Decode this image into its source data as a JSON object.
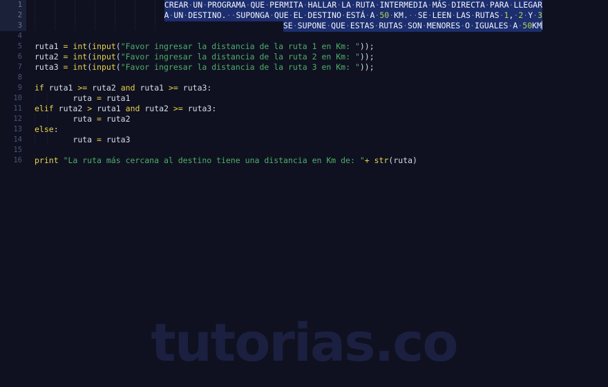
{
  "editor": {
    "background": "#0f1120",
    "gutter_color": "#4a5375",
    "selection_color": "#1c2e6e",
    "language": "python"
  },
  "watermark": {
    "text": "tutorias.co",
    "color": "#1b2040"
  },
  "gutter": {
    "numbers": [
      "1",
      "2",
      "3",
      "4",
      "5",
      "6",
      "7",
      "8",
      "9",
      "10",
      "11",
      "12",
      "13",
      "14",
      "15",
      "16"
    ]
  },
  "selection": {
    "active": true,
    "lines": [
      1,
      2,
      3
    ],
    "text": "CREAR UN PROGRAMA QUE PERMITA HALLAR LA RUTA INTERMEDIA MÁS DIRECTA PARA LLEGAR A UN DESTINO. SUPONGA QUE EL DESTINO ESTÁ A 50 KM. SE LEEN LAS RUTAS 1, 2 Y 3 SE SUPONE QUE ESTAS RUTAS SON MENORES O IGUALES A 50KM"
  },
  "comment_block": {
    "line1": {
      "parts": [
        {
          "text": "CREAR",
          "kind": "word"
        },
        {
          "text": "UN",
          "kind": "word"
        },
        {
          "text": "PROGRAMA",
          "kind": "word"
        },
        {
          "text": "QUE",
          "kind": "word"
        },
        {
          "text": "PERMITA",
          "kind": "word"
        },
        {
          "text": "HALLAR",
          "kind": "word"
        },
        {
          "text": "LA",
          "kind": "word"
        },
        {
          "text": "RUTA",
          "kind": "word"
        },
        {
          "text": "INTERMEDIA",
          "kind": "word"
        },
        {
          "text": "MÁS",
          "kind": "word"
        },
        {
          "text": "DIRECTA",
          "kind": "word"
        },
        {
          "text": "PARA",
          "kind": "word"
        },
        {
          "text": "LLEGAR",
          "kind": "word"
        }
      ]
    },
    "line2": {
      "parts": [
        {
          "text": "A",
          "kind": "word"
        },
        {
          "text": "UN",
          "kind": "word"
        },
        {
          "text": "DESTINO.",
          "kind": "word"
        },
        {
          "text": "",
          "kind": "word"
        },
        {
          "text": "SUPONGA",
          "kind": "word"
        },
        {
          "text": "QUE",
          "kind": "word"
        },
        {
          "text": "EL",
          "kind": "word"
        },
        {
          "text": "DESTINO",
          "kind": "word"
        },
        {
          "text": "ESTÁ",
          "kind": "word"
        },
        {
          "text": "A",
          "kind": "word"
        },
        {
          "text": "50",
          "kind": "num"
        },
        {
          "text": "KM.",
          "kind": "word"
        },
        {
          "text": "",
          "kind": "word"
        },
        {
          "text": "SE",
          "kind": "word"
        },
        {
          "text": "LEEN",
          "kind": "word"
        },
        {
          "text": "LAS",
          "kind": "word"
        },
        {
          "text": "RUTAS",
          "kind": "word"
        },
        {
          "text": "1",
          "kind": "num"
        },
        {
          "text": ",",
          "kind": "punct-inline"
        },
        {
          "text": "2",
          "kind": "num"
        },
        {
          "text": "Y",
          "kind": "word"
        },
        {
          "text": "3",
          "kind": "num"
        }
      ]
    },
    "line3": {
      "parts": [
        {
          "text": "SE",
          "kind": "word"
        },
        {
          "text": "SUPONE",
          "kind": "word"
        },
        {
          "text": "QUE",
          "kind": "word"
        },
        {
          "text": "ESTAS",
          "kind": "word"
        },
        {
          "text": "RUTAS",
          "kind": "word"
        },
        {
          "text": "SON",
          "kind": "word"
        },
        {
          "text": "MENORES",
          "kind": "word"
        },
        {
          "text": "O",
          "kind": "word"
        },
        {
          "text": "IGUALES",
          "kind": "word"
        },
        {
          "text": "A",
          "kind": "word"
        },
        {
          "text": "50KM",
          "kind": "mixed",
          "num": "50",
          "word": "KM"
        }
      ]
    }
  },
  "code": {
    "line5": "ruta1 = int(input(\"Favor ingresar la distancia de la ruta 1 en Km: \"));",
    "line6": "ruta2 = int(input(\"Favor ingresar la distancia de la ruta 2 en Km: \"));",
    "line7": "ruta3 = int(input(\"Favor ingresar la distancia de la ruta 3 en Km: \"));",
    "line9": "if ruta1 >= ruta2 and ruta1 >= ruta3:",
    "line10": "        ruta = ruta1",
    "line11": "elif ruta2 > ruta1 and ruta2 >= ruta3:",
    "line12": "        ruta = ruta2",
    "line13": "else:",
    "line14": "        ruta = ruta3",
    "line16": "print \"La ruta más cercana al destino tiene una distancia en Km de: \"+ str(ruta)"
  },
  "tokens": {
    "var_ruta1": "ruta1",
    "var_ruta2": "ruta2",
    "var_ruta3": "ruta3",
    "var_ruta": "ruta",
    "eq": " = ",
    "fn_int": "int",
    "fn_input": "input",
    "fn_str": "str",
    "kw_if": "if",
    "kw_elif": "elif",
    "kw_else": "else",
    "kw_and": "and",
    "kw_print": "print",
    "op_ge": ">=",
    "op_gt": ">",
    "op_plus": "+",
    "colon": ":",
    "semis": "));",
    "prompt1": "\"Favor ingresar la distancia de la ruta 1 en Km: \"",
    "prompt2": "\"Favor ingresar la distancia de la ruta 2 en Km: \"",
    "prompt3": "\"Favor ingresar la distancia de la ruta 3 en Km: \"",
    "output_msg": "\"La ruta más cercana al destino tiene una distancia en Km de: \"",
    "open_paren2": "(",
    "close_paren": ")",
    "indent8": "        "
  }
}
